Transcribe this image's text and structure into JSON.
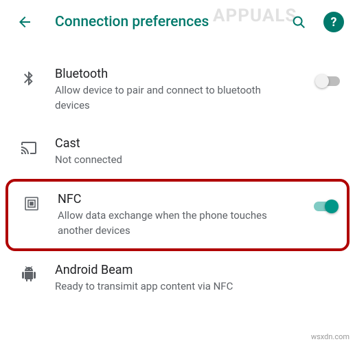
{
  "colors": {
    "accent": "#00796b",
    "switchOn": "#009688",
    "highlight": "#b00000"
  },
  "header": {
    "title": "Connection preferences"
  },
  "watermark": "APPUALS",
  "footerMark": "wsxdn.com",
  "items": [
    {
      "icon": "bluetooth",
      "title": "Bluetooth",
      "subtitle": "Allow device to pair and connect to bluetooth devices",
      "toggle": {
        "present": true,
        "on": false
      }
    },
    {
      "icon": "cast",
      "title": "Cast",
      "subtitle": "Not connected",
      "toggle": {
        "present": false
      }
    },
    {
      "icon": "nfc",
      "title": "NFC",
      "subtitle": "Allow data exchange when the phone touches another devices",
      "toggle": {
        "present": true,
        "on": true
      },
      "highlighted": true
    },
    {
      "icon": "android",
      "title": "Android Beam",
      "subtitle": "Ready to transimit app content via NFC",
      "toggle": {
        "present": false
      }
    }
  ]
}
